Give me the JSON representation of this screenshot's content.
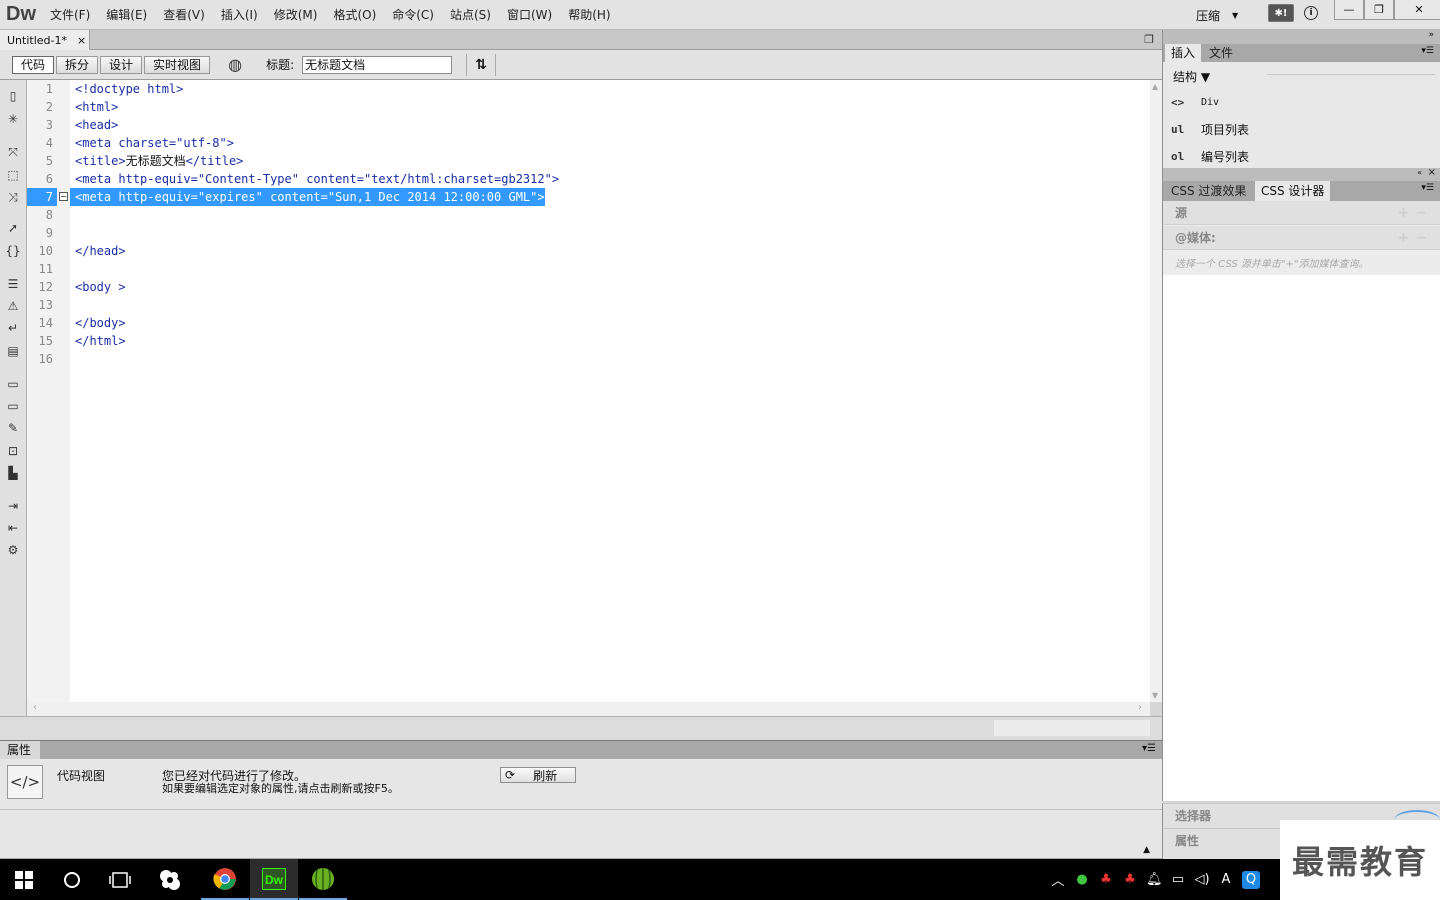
{
  "app": {
    "logo": "Dw",
    "menus": [
      "文件(F)",
      "编辑(E)",
      "查看(V)",
      "插入(I)",
      "修改(M)",
      "格式(O)",
      "命令(C)",
      "站点(S)",
      "窗口(W)",
      "帮助(H)"
    ],
    "layout_label": "压缩",
    "window_controls": [
      "—",
      "❐",
      "✕"
    ]
  },
  "document": {
    "tab_label": "Untitled-1*",
    "tab_close": "×",
    "view_buttons": [
      "代码",
      "拆分",
      "设计",
      "实时视图"
    ],
    "title_label": "标题:",
    "title_value": "无标题文档"
  },
  "code": {
    "current_line": 7,
    "lines": [
      {
        "n": "1",
        "text": "<!doctype html>"
      },
      {
        "n": "2",
        "text": "<html>"
      },
      {
        "n": "3",
        "text": "<head>"
      },
      {
        "n": "4",
        "text": "<meta charset=\"utf-8\">"
      },
      {
        "n": "5",
        "pre": "<title>",
        "mid": "无标题文档",
        "post": "</title>"
      },
      {
        "n": "6",
        "text": "<meta http-equiv=\"Content-Type\" content=\"text/html:charset=gb2312\">"
      },
      {
        "n": "7",
        "text": "<meta http-equiv=\"expires\" content=\"Sun,1 Dec 2014 12:00:00 GML\">"
      },
      {
        "n": "8",
        "text": ""
      },
      {
        "n": "9",
        "text": ""
      },
      {
        "n": "10",
        "text": "</head>"
      },
      {
        "n": "11",
        "text": ""
      },
      {
        "n": "12",
        "text": "<body >"
      },
      {
        "n": "13",
        "text": ""
      },
      {
        "n": "14",
        "text": "</body>"
      },
      {
        "n": "15",
        "text": "</html>"
      },
      {
        "n": "16",
        "text": ""
      }
    ]
  },
  "properties": {
    "tab_label": "属性",
    "view_label": "代码视图",
    "message_line1": "您已经对代码进行了修改。",
    "message_line2": "如果要编辑选定对象的属性,请点击刷新或按F5。",
    "refresh_label": "刷新"
  },
  "insert_panel": {
    "tabs": [
      "插入",
      "文件"
    ],
    "category": "结构",
    "items": [
      {
        "icon": "<>",
        "label": "Div"
      },
      {
        "icon": "ul",
        "label": "项目列表"
      },
      {
        "icon": "ol",
        "label": "编号列表"
      }
    ]
  },
  "css_panel": {
    "tabs": [
      "CSS 过渡效果",
      "CSS 设计器"
    ],
    "source_label": "源",
    "media_label": "@媒体:",
    "media_hint": "选择一个 CSS 源并单击\"+\"添加媒体查询。",
    "selector_label": "选择器",
    "property_label": "属性"
  },
  "watermark": "最需教育",
  "taskbar": {
    "apps": [
      "windows-start",
      "cortana",
      "task-view",
      "app-s",
      "chrome",
      "dreamweaver",
      "melon-app"
    ],
    "tray_ime": "A"
  },
  "colors": {
    "selection": "#3399ff",
    "code_tag": "#1a2ea6",
    "taskbar": "#000000"
  }
}
